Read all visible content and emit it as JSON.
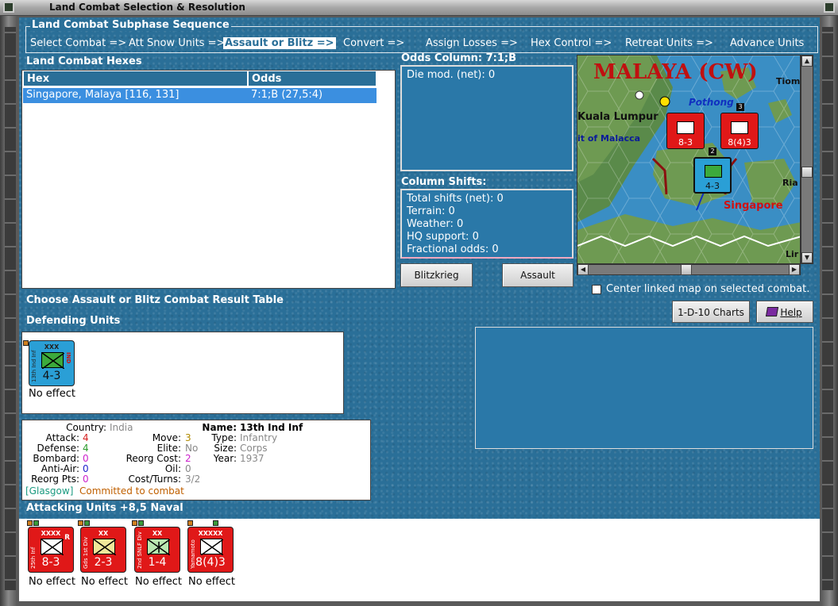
{
  "window": {
    "title": "Land Combat Selection & Resolution"
  },
  "sequence": {
    "title": "Land Combat Subphase Sequence",
    "items": [
      {
        "label": "Select Combat =>"
      },
      {
        "label": "Att Snow Units =>"
      },
      {
        "label": "Assault or Blitz =>",
        "active": true
      },
      {
        "label": "Convert =>"
      },
      {
        "label": "Assign Losses =>"
      },
      {
        "label": "Hex Control =>"
      },
      {
        "label": "Retreat Units =>"
      },
      {
        "label": "Advance Units"
      }
    ]
  },
  "hexes": {
    "title": "Land Combat Hexes",
    "columns": [
      "Hex",
      "Odds"
    ],
    "rows": [
      {
        "hex": "Singapore, Malaya [116, 131]",
        "odds": "7:1;B (27,5:4)"
      }
    ]
  },
  "odds": {
    "title": "Odds Column: 7:1;B",
    "die_mod": "Die mod. (net): 0"
  },
  "shifts": {
    "title": "Column Shifts:",
    "lines": [
      "Total shifts (net): 0",
      "Terrain: 0",
      "Weather: 0",
      "HQ support: 0",
      "Fractional odds: 0"
    ]
  },
  "buttons": {
    "blitzkrieg": "Blitzkrieg",
    "assault": "Assault",
    "charts": "1-D-10 Charts",
    "help": "Help"
  },
  "map": {
    "region": "MALAYA (CW)",
    "places": [
      "Kuala Lumpur",
      "Pothong",
      "it of Malacca",
      "Singapore",
      "Tiom",
      "Ria",
      "Lir"
    ],
    "stack_counts": [
      "3",
      "2"
    ]
  },
  "center_linked_label": "Center linked map on selected combat.",
  "choose_label": "Choose Assault or Blitz Combat Result Table",
  "defending": {
    "title": "Defending Units",
    "units": [
      {
        "size": "XXX",
        "name": "13th Ind Inf",
        "strength": "4-3",
        "side": "IND",
        "status": "No effect",
        "color": "#2a9fd6",
        "symbol_color": "#3caa3c"
      }
    ]
  },
  "details": {
    "left": [
      {
        "label": "Country:",
        "value": "India",
        "color": "#888888"
      },
      {
        "label": "Attack:",
        "value": "4",
        "color": "#d42020"
      },
      {
        "label": "Defense:",
        "value": "4",
        "color": "#2a9a2a"
      },
      {
        "label": "Bombard:",
        "value": "0",
        "color": "#cc22cc"
      },
      {
        "label": "Anti-Air:",
        "value": "0",
        "color": "#2222cc"
      },
      {
        "label": "Reorg Pts:",
        "value": "0",
        "color": "#cc22cc"
      }
    ],
    "mid": [
      {
        "label": "Move:",
        "value": "3",
        "color": "#b08a00"
      },
      {
        "label": "Elite:",
        "value": "No",
        "color": "#888888"
      },
      {
        "label": "Reorg Cost:",
        "value": "2",
        "color": "#cc22cc"
      },
      {
        "label": "Oil:",
        "value": "0",
        "color": "#888888"
      },
      {
        "label": "Cost/Turns:",
        "value": "3/2",
        "color": "#888888"
      }
    ],
    "right": [
      {
        "label": "Name:",
        "value": "13th Ind Inf",
        "color": "#000000",
        "bold": true
      },
      {
        "label": "Type:",
        "value": "Infantry",
        "color": "#888888"
      },
      {
        "label": "Size:",
        "value": "Corps",
        "color": "#888888"
      },
      {
        "label": "Year:",
        "value": "1937",
        "color": "#888888"
      }
    ],
    "footer_loc": "[Glasgow]",
    "footer_status": "Committed to combat"
  },
  "attacking": {
    "title": "Attacking Units +8,5 Naval",
    "units": [
      {
        "size": "XXXX",
        "name": "25th Inf",
        "strength": "8-3",
        "status": "No effect",
        "mark": "R",
        "symbol_color": "#ffffff"
      },
      {
        "size": "XX",
        "name": "Gds 1st Div",
        "strength": "2-3",
        "status": "No effect",
        "mark": "",
        "symbol_color": "#f0e89a"
      },
      {
        "size": "XX",
        "name": "2nd SNLF Div",
        "strength": "1-4",
        "status": "No effect",
        "mark": "",
        "symbol_color": "#b8e8b0"
      },
      {
        "size": "XXXXX",
        "name": "Yamamoto",
        "strength": "8(4)3",
        "status": "No effect",
        "mark": "",
        "symbol_color": "#ffffff"
      }
    ]
  }
}
